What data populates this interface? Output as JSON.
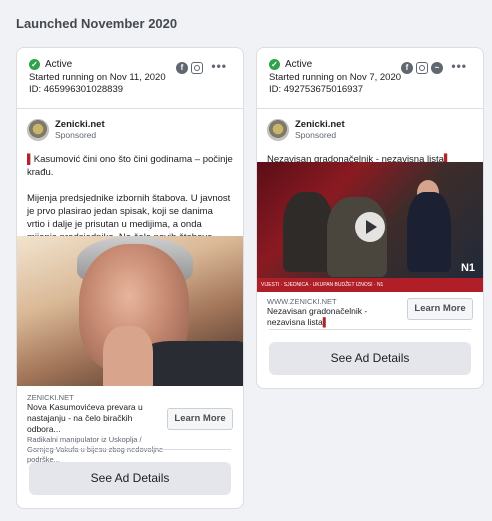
{
  "section": {
    "title": "Launched November 2020"
  },
  "ads": [
    {
      "status": "Active",
      "started": "Started running on Nov 11, 2020",
      "id": "ID: 465996301028839",
      "platforms": [
        "facebook-icon",
        "instagram-icon"
      ],
      "advertiser": "Zenicki.net",
      "sponsored": "Sponsored",
      "body": [
        "Kasumović čini ono što čini godinama – počinje krađu.",
        "Mijenja predsjednike izbornih štabova. U javnost je prvo plasirao jedan spisak, koji se danima vrtio i dalje je prisutan u medijima, a onda mijenja predsjednike. Na čelo novih štabova dolaze najodaniji kadrovi,..."
      ],
      "link_domain": "ZENICKI.NET",
      "link_title": "Nova Kasumovićeva prevara u nastajanju - na čelo biračkih odbora...",
      "link_desc": "Radikalni manipulator iz Uskoplja / Gornjeg Vakufa u bijesu zbog nedovoljne podrške...",
      "cta": "Learn More",
      "details": "See Ad Details"
    },
    {
      "status": "Active",
      "started": "Started running on Nov 7, 2020",
      "id": "ID: 492753675016937",
      "platforms": [
        "facebook-icon",
        "instagram-icon",
        "messenger-icon"
      ],
      "advertiser": "Zenicki.net",
      "sponsored": "Sponsored",
      "body": [
        "Nezavisan gradonačelnik - nezavisna lista"
      ],
      "video_ticker": "VIJESTI · SJEDNICA · UKUPAN BUDŽET IZNOSI · N1",
      "video_logo": "N1",
      "link_domain": "WWW.ZENICKI.NET",
      "link_title": "Nezavisan gradonačelnik - nezavisna lista",
      "cta": "Learn More",
      "details": "See Ad Details"
    }
  ],
  "colors": {
    "active": "#31a24c",
    "marker": "#b0242b",
    "button_bg": "#e4e6eb"
  },
  "more_label": "•••"
}
